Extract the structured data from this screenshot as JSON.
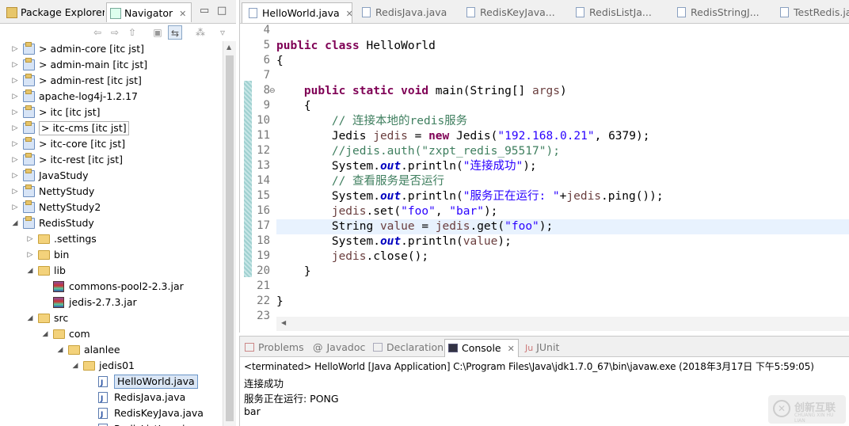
{
  "left_panel": {
    "tabs": [
      {
        "label": "Package Explorer"
      },
      {
        "label": "Navigator",
        "close": "✕"
      }
    ],
    "tree": [
      {
        "twisty": "▷",
        "icon": "project",
        "label": "> admin-core  [itc jst]"
      },
      {
        "twisty": "▷",
        "icon": "project",
        "label": "> admin-main  [itc jst]"
      },
      {
        "twisty": "▷",
        "icon": "project",
        "label": "> admin-rest  [itc jst]"
      },
      {
        "twisty": "▷",
        "icon": "project",
        "label": "apache-log4j-1.2.17"
      },
      {
        "twisty": "▷",
        "icon": "project",
        "label": "> itc  [itc jst]"
      },
      {
        "twisty": "▷",
        "icon": "project",
        "label": "> itc-cms  [itc jst]"
      },
      {
        "twisty": "▷",
        "icon": "project",
        "label": "> itc-core  [itc jst]"
      },
      {
        "twisty": "▷",
        "icon": "project",
        "label": "> itc-rest  [itc jst]"
      },
      {
        "twisty": "▷",
        "icon": "project",
        "label": "JavaStudy"
      },
      {
        "twisty": "▷",
        "icon": "project",
        "label": "NettyStudy"
      },
      {
        "twisty": "▷",
        "icon": "project",
        "label": "NettyStudy2"
      },
      {
        "twisty": "◢",
        "icon": "project",
        "label": "RedisStudy"
      },
      {
        "twisty": "▷",
        "icon": "folder",
        "label": ".settings"
      },
      {
        "twisty": "▷",
        "icon": "folder",
        "label": "bin"
      },
      {
        "twisty": "◢",
        "icon": "folder",
        "label": "lib"
      },
      {
        "twisty": "",
        "icon": "jar",
        "label": "commons-pool2-2.3.jar"
      },
      {
        "twisty": "",
        "icon": "jar",
        "label": "jedis-2.7.3.jar"
      },
      {
        "twisty": "◢",
        "icon": "folder",
        "label": "src"
      },
      {
        "twisty": "◢",
        "icon": "folder",
        "label": "com"
      },
      {
        "twisty": "◢",
        "icon": "folder",
        "label": "alanlee"
      },
      {
        "twisty": "◢",
        "icon": "folder",
        "label": "jedis01"
      },
      {
        "twisty": "",
        "icon": "java",
        "label": "HelloWorld.java"
      },
      {
        "twisty": "",
        "icon": "java",
        "label": "RedisJava.java"
      },
      {
        "twisty": "",
        "icon": "java",
        "label": "RedisKeyJava.java"
      },
      {
        "twisty": "",
        "icon": "java",
        "label": "RedisListJava.java"
      }
    ]
  },
  "editor": {
    "tabs": [
      {
        "label": "HelloWorld.java",
        "close": "✕"
      },
      {
        "label": "RedisJava.java"
      },
      {
        "label": "RedisKeyJava..."
      },
      {
        "label": "RedisListJa..."
      },
      {
        "label": "RedisStringJ..."
      },
      {
        "label": "TestRedis.java"
      }
    ],
    "line_numbers": [
      "4",
      "5",
      "6",
      "7",
      "8",
      "9",
      "10",
      "11",
      "12",
      "13",
      "14",
      "15",
      "16",
      "17",
      "18",
      "19",
      "20",
      "21",
      "22",
      "23"
    ],
    "lines": [
      [],
      [
        {
          "t": "public class",
          "c": "kw"
        },
        {
          "t": " HelloWorld"
        }
      ],
      [
        {
          "t": "{"
        }
      ],
      [],
      [
        {
          "t": "    "
        },
        {
          "t": "public static void",
          "c": "kw"
        },
        {
          "t": " main(String[] "
        },
        {
          "t": "args",
          "c": "vr"
        },
        {
          "t": ")"
        }
      ],
      [
        {
          "t": "    {"
        }
      ],
      [
        {
          "t": "        // 连接本地的redis服务",
          "c": "cm"
        }
      ],
      [
        {
          "t": "        Jedis "
        },
        {
          "t": "jedis",
          "c": "vr"
        },
        {
          "t": " = "
        },
        {
          "t": "new",
          "c": "kw"
        },
        {
          "t": " Jedis("
        },
        {
          "t": "\"192.168.0.21\"",
          "c": "str"
        },
        {
          "t": ", 6379);"
        }
      ],
      [
        {
          "t": "        //jedis.auth(\"zxpt_redis_95517\");",
          "c": "cm"
        }
      ],
      [
        {
          "t": "        System."
        },
        {
          "t": "out",
          "c": "fld"
        },
        {
          "t": ".println("
        },
        {
          "t": "\"连接成功\"",
          "c": "str"
        },
        {
          "t": ");"
        }
      ],
      [
        {
          "t": "        // 查看服务是否运行",
          "c": "cm"
        }
      ],
      [
        {
          "t": "        System."
        },
        {
          "t": "out",
          "c": "fld"
        },
        {
          "t": ".println("
        },
        {
          "t": "\"服务正在运行: \"",
          "c": "str"
        },
        {
          "t": "+"
        },
        {
          "t": "jedis",
          "c": "vr"
        },
        {
          "t": ".ping());"
        }
      ],
      [
        {
          "t": "        "
        },
        {
          "t": "jedis",
          "c": "vr"
        },
        {
          "t": ".set("
        },
        {
          "t": "\"foo\"",
          "c": "str"
        },
        {
          "t": ", "
        },
        {
          "t": "\"bar\"",
          "c": "str"
        },
        {
          "t": ");"
        }
      ],
      [
        {
          "t": "        String "
        },
        {
          "t": "value",
          "c": "vr"
        },
        {
          "t": " = "
        },
        {
          "t": "jedis",
          "c": "vr"
        },
        {
          "t": ".get("
        },
        {
          "t": "\"foo\"",
          "c": "str"
        },
        {
          "t": ");"
        }
      ],
      [
        {
          "t": "        System."
        },
        {
          "t": "out",
          "c": "fld"
        },
        {
          "t": ".println("
        },
        {
          "t": "value",
          "c": "vr"
        },
        {
          "t": ");"
        }
      ],
      [
        {
          "t": "        "
        },
        {
          "t": "jedis",
          "c": "vr"
        },
        {
          "t": ".close();"
        }
      ],
      [
        {
          "t": "    }"
        }
      ],
      [],
      [
        {
          "t": "}"
        }
      ],
      []
    ],
    "current_line": "17"
  },
  "console": {
    "tabs": [
      {
        "label": "Problems"
      },
      {
        "label": "Javadoc"
      },
      {
        "label": "Declaration"
      },
      {
        "label": "Console",
        "close": "✕"
      },
      {
        "label": "JUnit"
      }
    ],
    "info": "<terminated> HelloWorld [Java Application] C:\\Program Files\\Java\\jdk1.7.0_67\\bin\\javaw.exe (2018年3月17日 下午5:59:05)",
    "output": [
      "连接成功",
      "服务正在运行: PONG",
      "bar"
    ]
  },
  "watermark": {
    "title": "创新互联",
    "subtitle": "CHUANG XIN HU LIAN"
  }
}
